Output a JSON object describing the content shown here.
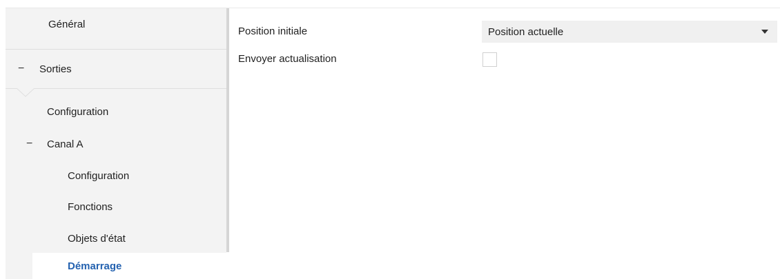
{
  "sidebar": {
    "general": "Général",
    "sorties": "Sorties",
    "configuration": "Configuration",
    "canal_a": "Canal A",
    "canal_a_items": [
      "Configuration",
      "Fonctions",
      "Objets d'état",
      "Démarrage"
    ],
    "collapse_symbol": "−",
    "selected_item": "Démarrage"
  },
  "main": {
    "position_initiale_label": "Position initiale",
    "position_initiale_value": "Position actuelle",
    "envoyer_label": "Envoyer actualisation",
    "envoyer_checked": false
  },
  "colors": {
    "accent": "#2462b0",
    "sidebar_bg": "#f3f3f3",
    "field_bg": "#f0f0f0"
  },
  "icons": {
    "dropdown": "triangle-down",
    "collapse": "minus"
  }
}
